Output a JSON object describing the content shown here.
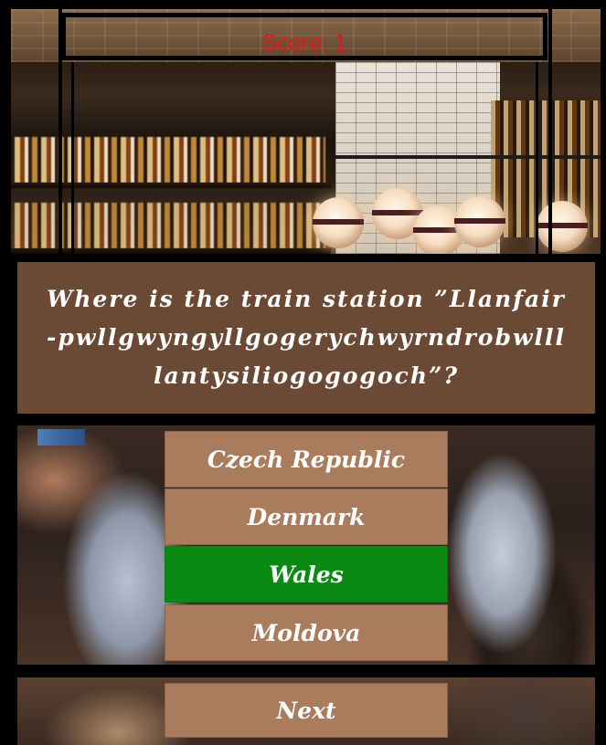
{
  "score": {
    "label": "Score: 1"
  },
  "question": {
    "text": "Where is the train station ”Llanfair-pwllgwyngyllgogerychwyrndrobwllllantysiliogogogoch”?"
  },
  "answers": [
    {
      "label": "Czech Republic",
      "state": "default"
    },
    {
      "label": "Denmark",
      "state": "default"
    },
    {
      "label": "Wales",
      "state": "correct"
    },
    {
      "label": "Moldova",
      "state": "default"
    }
  ],
  "next_button": {
    "label": "Next"
  },
  "colors": {
    "answer_default": "#a87c5c",
    "answer_correct": "#0b8a13",
    "question_panel": "#6a4a34",
    "score_text": "#e8141c"
  }
}
